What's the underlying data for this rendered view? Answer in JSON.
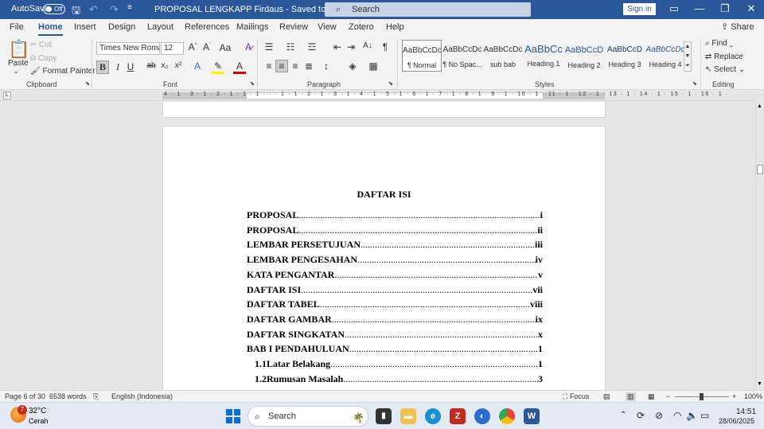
{
  "titlebar": {
    "autosave_label": "AutoSave",
    "autosave_state": "Off",
    "document_title": "PROPOSAL LENGKAPP Firdaus  -  Saved to this PC  ⌄",
    "search_placeholder": "Search",
    "signin_label": "Sign in"
  },
  "menu": {
    "tabs": [
      "File",
      "Home",
      "Insert",
      "Design",
      "Layout",
      "References",
      "Mailings",
      "Review",
      "View",
      "Zotero",
      "Help"
    ],
    "share_label": "Share"
  },
  "ribbon": {
    "clipboard": {
      "paste": "Paste",
      "cut": "Cut",
      "copy": "Copy",
      "format_painter": "Format Painter",
      "label": "Clipboard"
    },
    "font": {
      "family": "Times New Roma",
      "size": "12",
      "label": "Font"
    },
    "paragraph": {
      "label": "Paragraph"
    },
    "styles": {
      "label": "Styles",
      "items": [
        {
          "preview": "AaBbCcDc",
          "name": "¶ Normal"
        },
        {
          "preview": "AaBbCcDc",
          "name": "¶ No Spac..."
        },
        {
          "preview": "AaBbCcDc",
          "name": "sub bab"
        },
        {
          "preview": "AaBbCc",
          "name": "Heading 1"
        },
        {
          "preview": "AaBbCcD",
          "name": "Heading 2"
        },
        {
          "preview": "AaBbCcD",
          "name": "Heading 3"
        },
        {
          "preview": "AaBbCcDc",
          "name": "Heading 4"
        }
      ]
    },
    "editing": {
      "find": "Find",
      "replace": "Replace",
      "select": "Select",
      "label": "Editing"
    }
  },
  "ruler": {
    "numbers": "4 · 1 · 3 · 1 · 2 · 1 · 1 · 1 · · · 1 · 1 · 2 · 1 · 3 · 1 · 4 · 1 · 5 · 1 · 6 · 1 · 7 · 1 · 8 · 1 · 9 · 1 · 10 · 1 · 11 · 1 · 12 · 1 · 13 · 1 · 14 · 1 · 15 · 1 · 16 · 1 ·"
  },
  "document": {
    "heading": "DAFTAR ISI",
    "toc": [
      {
        "label": "PROPOSAL",
        "page": "i"
      },
      {
        "label": "PROPOSAL",
        "page": "ii"
      },
      {
        "label": "LEMBAR PERSETUJUAN",
        "page": "iii"
      },
      {
        "label": "LEMBAR PENGESAHAN",
        "page": "iv"
      },
      {
        "label": "KATA PENGANTAR",
        "page": "v"
      },
      {
        "label": "DAFTAR ISI",
        "page": "vii"
      },
      {
        "label": "DAFTAR TABEL",
        "page": "viii"
      },
      {
        "label": "DAFTAR GAMBAR",
        "page": "ix"
      },
      {
        "label": "DAFTAR SINGKATAN",
        "page": "x"
      },
      {
        "label": "BAB I PENDAHULUAN",
        "page": "1"
      },
      {
        "num": "1.1",
        "label": "Latar Belakang",
        "page": "1"
      },
      {
        "num": "1.2",
        "label": "Rumusan Masalah",
        "page": "3"
      }
    ]
  },
  "status": {
    "page": "Page 6 of 30",
    "words": "6538 words",
    "language": "English (Indonesia)",
    "focus": "Focus",
    "zoom": "100%"
  },
  "taskbar": {
    "temperature": "32°C",
    "condition": "Cerah",
    "badge": "7",
    "search": "Search",
    "time": "14:51",
    "date": "28/06/2025"
  }
}
